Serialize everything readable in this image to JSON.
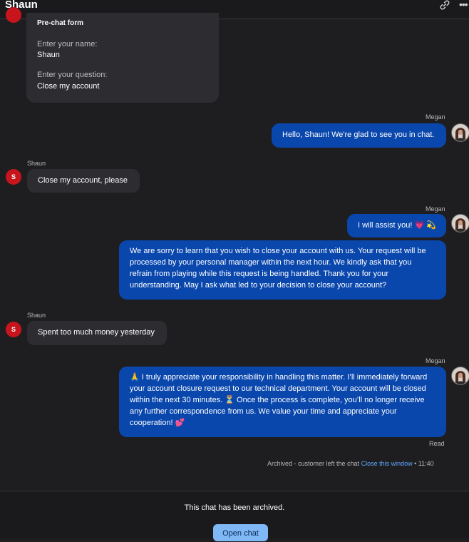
{
  "header": {
    "title": "Shaun",
    "link_icon": "link-icon",
    "more_icon": "more-icon"
  },
  "prechat": {
    "title": "Pre-chat form",
    "name_label": "Enter your name:",
    "name_value": "Shaun",
    "question_label": "Enter your question:",
    "question_value": "Close my account"
  },
  "messages": [
    {
      "sender": "Megan",
      "lines": [
        "Hello, Shaun! We're glad to see you in chat."
      ]
    },
    {
      "sender": "Shaun",
      "avatar_initial": "S",
      "lines": [
        "Close my account, please"
      ]
    },
    {
      "sender": "Megan",
      "lines": [
        "I will assist you! 💗 💫"
      ]
    },
    {
      "lines": [
        "We are sorry to learn that you wish to close your account with us. Your request will be",
        "processed by your personal manager within the next hour. We kindly ask that you",
        "refrain from playing while this request is being handled. Thank you for your",
        "understanding. May I ask what led to your decision to close your account?"
      ]
    },
    {
      "sender": "Shaun",
      "avatar_initial": "S",
      "lines": [
        "Spent too much money yesterday"
      ]
    },
    {
      "sender": "Megan",
      "lines": [
        "🙏 I truly appreciate your responsibility in handling this matter. I’ll immediately forward",
        "your account closure request to our technical department. Your account will be closed",
        "within the next 30 minutes. ⏳ Once the process is complete, you’ll no longer receive",
        "any further correspondence from us. We value your time and appreciate your",
        "cooperation! 💕"
      ]
    }
  ],
  "status": {
    "read": "Read",
    "archived_note": "Archived - customer left the chat",
    "close_window": "Close this window",
    "time": "• 11:40"
  },
  "footer": {
    "archived_message": "This chat has been archived.",
    "open_chat_label": "Open chat"
  },
  "colors": {
    "outgoing_bubble": "#0a47ad",
    "incoming_bubble": "#2d2d31",
    "avatar_red": "#c8141c",
    "link": "#5ea6ff"
  }
}
